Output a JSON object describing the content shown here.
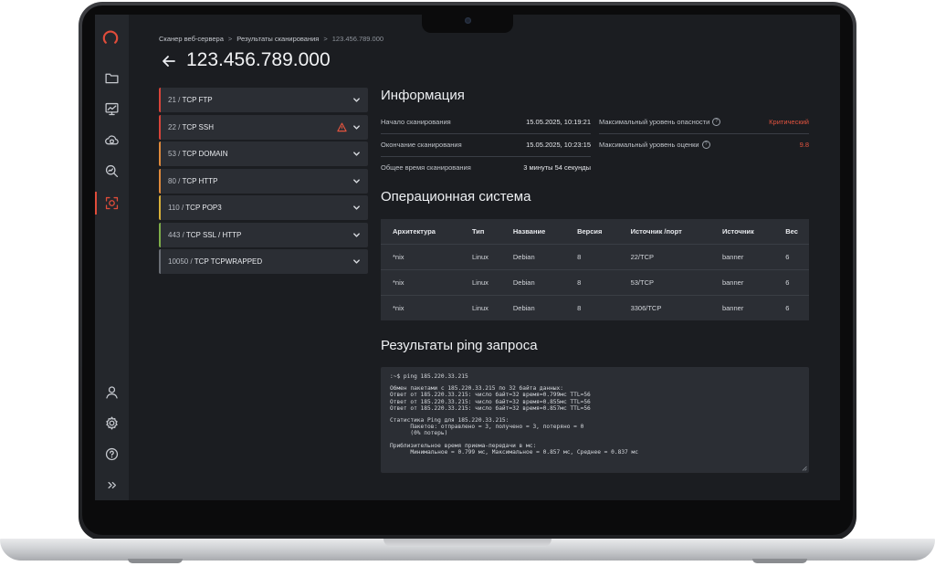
{
  "breadcrumb": {
    "items": [
      "Сканер веб-сервера",
      "Результаты сканирования",
      "123.456.789.000"
    ]
  },
  "page_title": "123.456.789.000",
  "sidebar": {
    "icons": [
      "logo-icon",
      "folder-icon",
      "monitor-chart-icon",
      "cloud-shield-icon",
      "search-chart-icon",
      "scan-target-icon",
      "user-icon",
      "gear-icon",
      "help-icon",
      "expand-icon"
    ],
    "active": "scan-target-icon"
  },
  "ports": [
    {
      "port": "21",
      "name": "TCP FTP",
      "accent": "#d8443a",
      "warning": false
    },
    {
      "port": "22",
      "name": "TCP SSH",
      "accent": "#d8443a",
      "warning": true
    },
    {
      "port": "53",
      "name": "TCP DOMAIN",
      "accent": "#e08a3c",
      "warning": false
    },
    {
      "port": "80",
      "name": "TCP HTTP",
      "accent": "#e08a3c",
      "warning": false
    },
    {
      "port": "110",
      "name": "TCP POP3",
      "accent": "#d9b13a",
      "warning": false
    },
    {
      "port": "443",
      "name": "TCP SSL / HTTP",
      "accent": "#7fae4a",
      "warning": false
    },
    {
      "port": "10050",
      "name": "TCP TCPWRAPPED",
      "accent": "#6a6e75",
      "warning": false
    }
  ],
  "info": {
    "heading": "Информация",
    "scan_start_label": "Начало сканирования",
    "scan_start_value": "15.05.2025, 10:19:21",
    "scan_end_label": "Окончание сканирования",
    "scan_end_value": "15.05.2025, 10:23:15",
    "scan_total_label": "Общее время сканирования",
    "scan_total_value": "3 минуты 54 секунды",
    "max_danger_label": "Максимальный уровень опасности",
    "max_danger_value": "Критический",
    "max_score_label": "Максимальный уровень оценки",
    "max_score_value": "9.8"
  },
  "os": {
    "heading": "Операционная система",
    "columns": [
      "Архитектура",
      "Тип",
      "Название",
      "Версия",
      "Источник /порт",
      "Источник",
      "Вес"
    ],
    "rows": [
      [
        "*nix",
        "Linux",
        "Debian",
        "8",
        "22/TCP",
        "banner",
        "6"
      ],
      [
        "*nix",
        "Linux",
        "Debian",
        "8",
        "53/TCP",
        "banner",
        "6"
      ],
      [
        "*nix",
        "Linux",
        "Debian",
        "8",
        "3306/TCP",
        "banner",
        "6"
      ]
    ]
  },
  "ping": {
    "heading": "Результаты ping запроса",
    "lines": [
      ":~$ ping 185.220.33.215",
      "",
      "Обмен пакетами с 185.220.33.215 по 32 байта данных:",
      "Ответ от 185.220.33.215: число байт=32 время=0.799мс TTL=56",
      "Ответ от 185.220.33.215: число байт=32 время=0.855мс TTL=56",
      "Ответ от 185.220.33.215: число байт=32 время=0.857мс TTL=56",
      "",
      "Статистика Ping для 185.220.33.215:",
      "      Пакетов: отправлено = 3, получено = 3, потеряно = 0",
      "      (0% потерь)",
      "",
      "Приблизительное время приема-передачи в мс:",
      "      Минимальное = 0.799 мс, Максимальное = 0.857 мс, Среднее = 0.837 мс"
    ]
  }
}
